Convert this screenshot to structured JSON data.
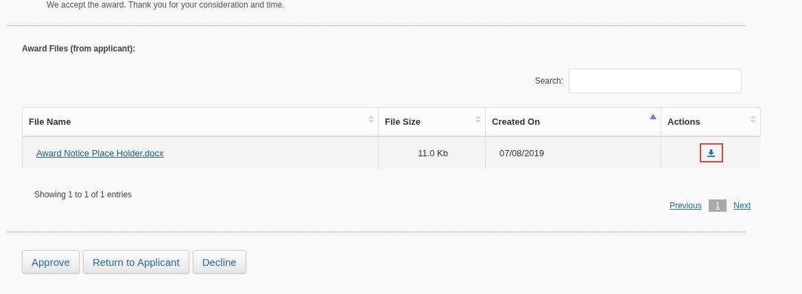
{
  "message": "We accept the award. Thank you for your consideration and time.",
  "section_title": "Award Files (from applicant):",
  "search": {
    "label": "Search:"
  },
  "table": {
    "columns": [
      {
        "label": "File Name",
        "sorted": false
      },
      {
        "label": "File Size",
        "sorted": false
      },
      {
        "label": "Created On",
        "sorted": true
      },
      {
        "label": "Actions",
        "sorted": false
      }
    ],
    "rows": [
      {
        "file_name": "Award Notice Place Holder.docx",
        "file_size": "11.0 Kb",
        "created_on": "07/08/2019",
        "download_highlighted": true
      }
    ]
  },
  "info": "Showing 1 to 1 of 1 entries",
  "pagination": {
    "previous": "Previous",
    "pages": [
      {
        "label": "1",
        "selected": true
      }
    ],
    "next": "Next"
  },
  "buttons": [
    "Approve",
    "Return to Applicant",
    "Decline"
  ]
}
